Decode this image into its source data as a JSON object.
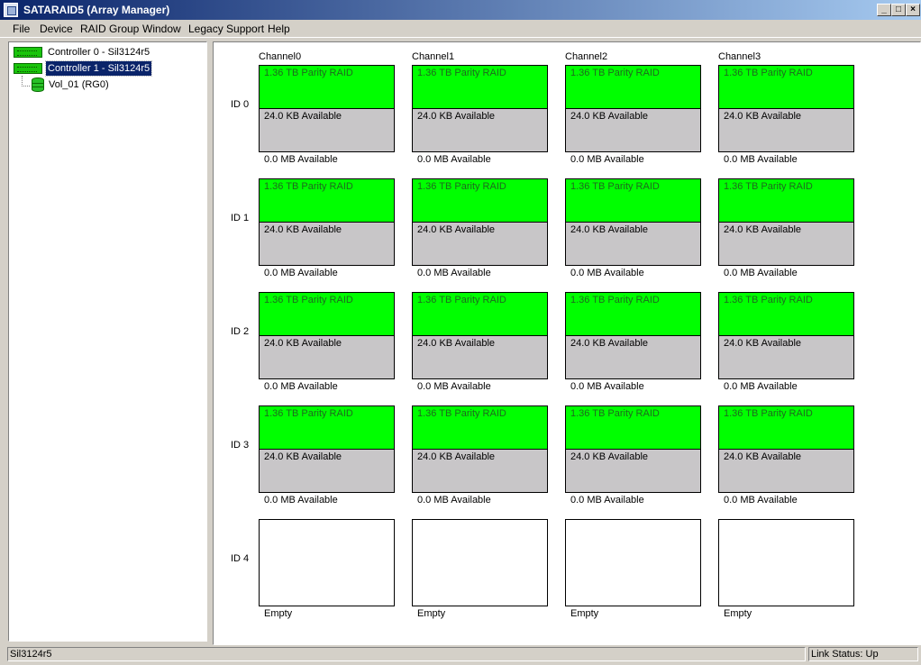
{
  "window": {
    "title": "SATARAID5 (Array Manager)",
    "minimize_glyph": "_",
    "maximize_glyph": "□",
    "close_glyph": "×"
  },
  "menu": [
    {
      "label": "File"
    },
    {
      "label": "Device"
    },
    {
      "label": "RAID Group"
    },
    {
      "label": "Window"
    },
    {
      "label": "Legacy Support"
    },
    {
      "label": "Help"
    }
  ],
  "tree": {
    "controllers": [
      {
        "label": "Controller 0 - Sil3124r5",
        "selected": false
      },
      {
        "label": "Controller 1 - Sil3124r5",
        "selected": true
      }
    ],
    "volume": {
      "label": "Vol_01 (RG0)"
    }
  },
  "grid": {
    "channels": [
      "Channel0",
      "Channel1",
      "Channel2",
      "Channel3"
    ],
    "ids": [
      "ID 0",
      "ID 1",
      "ID 2",
      "ID 3",
      "ID 4"
    ],
    "rows": [
      {
        "cells": [
          {
            "raid": "1.36 TB Parity RAID",
            "free": "24.0 KB Available",
            "caption": "0.0 MB Available"
          },
          {
            "raid": "1.36 TB Parity RAID",
            "free": "24.0 KB Available",
            "caption": "0.0 MB Available"
          },
          {
            "raid": "1.36 TB Parity RAID",
            "free": "24.0 KB Available",
            "caption": "0.0 MB Available"
          },
          {
            "raid": "1.36 TB Parity RAID",
            "free": "24.0 KB Available",
            "caption": "0.0 MB Available"
          }
        ]
      },
      {
        "cells": [
          {
            "raid": "1.36 TB Parity RAID",
            "free": "24.0 KB Available",
            "caption": "0.0 MB Available"
          },
          {
            "raid": "1.36 TB Parity RAID",
            "free": "24.0 KB Available",
            "caption": "0.0 MB Available"
          },
          {
            "raid": "1.36 TB Parity RAID",
            "free": "24.0 KB Available",
            "caption": "0.0 MB Available"
          },
          {
            "raid": "1.36 TB Parity RAID",
            "free": "24.0 KB Available",
            "caption": "0.0 MB Available"
          }
        ]
      },
      {
        "cells": [
          {
            "raid": "1.36 TB Parity RAID",
            "free": "24.0 KB Available",
            "caption": "0.0 MB Available"
          },
          {
            "raid": "1.36 TB Parity RAID",
            "free": "24.0 KB Available",
            "caption": "0.0 MB Available"
          },
          {
            "raid": "1.36 TB Parity RAID",
            "free": "24.0 KB Available",
            "caption": "0.0 MB Available"
          },
          {
            "raid": "1.36 TB Parity RAID",
            "free": "24.0 KB Available",
            "caption": "0.0 MB Available"
          }
        ]
      },
      {
        "cells": [
          {
            "raid": "1.36 TB Parity RAID",
            "free": "24.0 KB Available",
            "caption": "0.0 MB Available"
          },
          {
            "raid": "1.36 TB Parity RAID",
            "free": "24.0 KB Available",
            "caption": "0.0 MB Available"
          },
          {
            "raid": "1.36 TB Parity RAID",
            "free": "24.0 KB Available",
            "caption": "0.0 MB Available"
          },
          {
            "raid": "1.36 TB Parity RAID",
            "free": "24.0 KB Available",
            "caption": "0.0 MB Available"
          }
        ]
      },
      {
        "cells": [
          {
            "empty": true,
            "caption": "Empty"
          },
          {
            "empty": true,
            "caption": "Empty"
          },
          {
            "empty": true,
            "caption": "Empty"
          },
          {
            "empty": true,
            "caption": "Empty"
          }
        ]
      }
    ]
  },
  "status": {
    "left": "Sil3124r5",
    "right": "Link Status: Up"
  },
  "colors": {
    "raid_fill": "#00ff00",
    "free_fill": "#c8c6c8",
    "title_bar": "#0a246a",
    "selection": "#0a246a"
  },
  "icons": {
    "app": "array-manager-icon",
    "controller": "controller-card-icon",
    "volume": "disk-volume-icon"
  }
}
